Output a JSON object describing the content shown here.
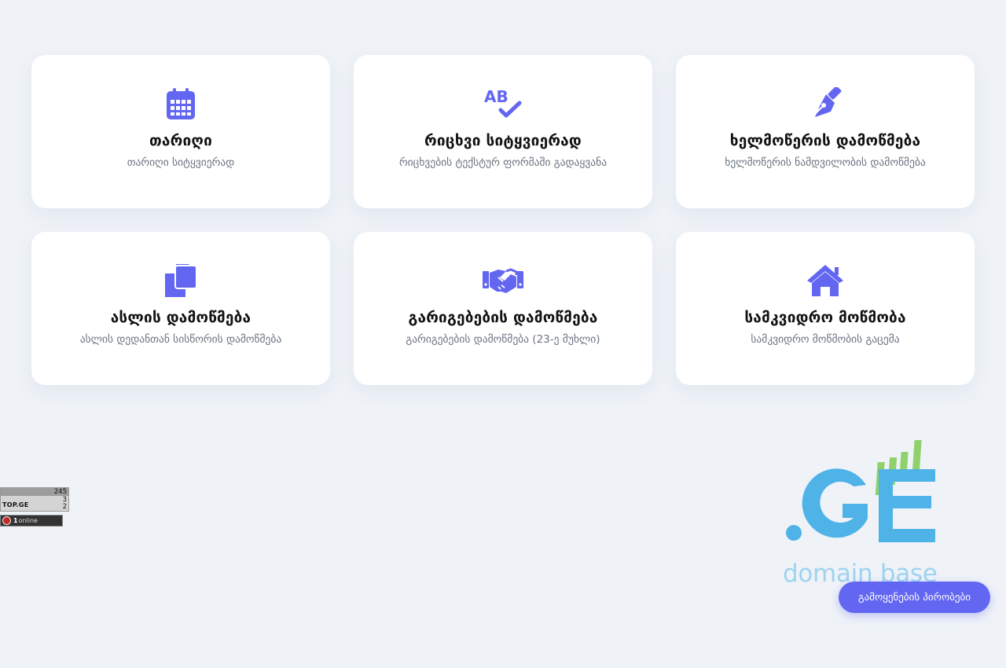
{
  "theme": {
    "accent": "#6366f1",
    "background": "#eff3f8",
    "card": "#ffffff"
  },
  "cards": [
    {
      "icon": "calendar-icon",
      "title": "თარიღი",
      "subtitle": "თარიღი სიტყვიერად"
    },
    {
      "icon": "spellcheck-icon",
      "title": "რიცხვი სიტყვიერად",
      "subtitle": "რიცხვების ტექსტურ ფორმაში გადაყვანა"
    },
    {
      "icon": "pen-nib-icon",
      "title": "ხელმოწერის დამოწმება",
      "subtitle": "ხელმოწერის ნამდვილობის დამოწმება"
    },
    {
      "icon": "copy-icon",
      "title": "ასლის დამოწმება",
      "subtitle": "ასლის დედანთან სისწორის დამოწმება"
    },
    {
      "icon": "handshake-icon",
      "title": "გარიგებების დამოწმება",
      "subtitle": "გარიგებების დამოწმება (23-ე მუხლი)"
    },
    {
      "icon": "home-icon",
      "title": "სამკვიდრო მოწმობა",
      "subtitle": "სამკვიდრო მოწმობის გაცემა"
    }
  ],
  "counter": {
    "v1": "245",
    "v2": "3",
    "v3": "2",
    "brand": "TOP.GE"
  },
  "online": {
    "count": "1",
    "label": "online"
  },
  "logo": {
    "mark": ".GE",
    "text": "domain base",
    "colors": {
      "blue": "#4fb3e8",
      "green": "#8fd16a"
    }
  },
  "footer": {
    "terms_label": "გამოყენების პირობები"
  }
}
